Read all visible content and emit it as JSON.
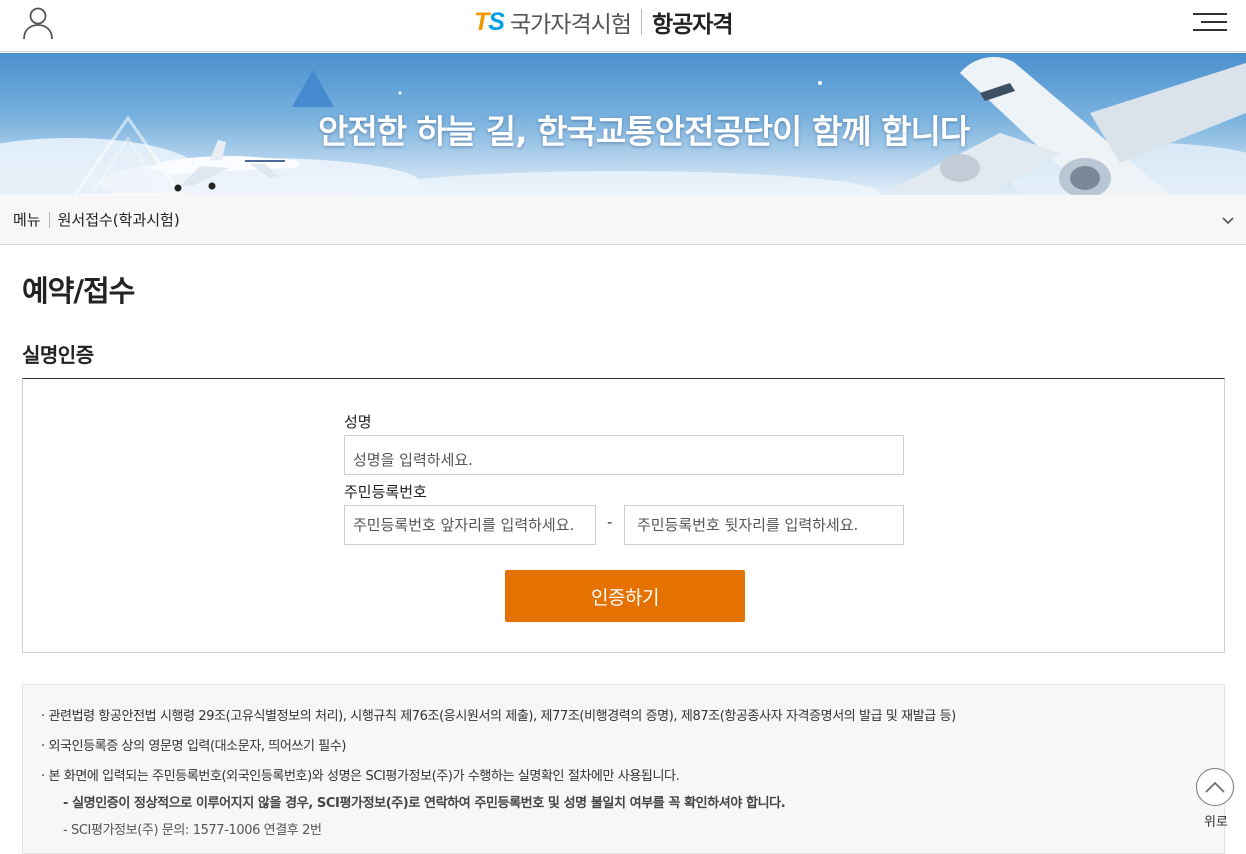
{
  "header": {
    "logo_t": "T",
    "logo_s": "S",
    "logo_name": "국가자격시험",
    "logo_sub": "항공자격",
    "user_icon": "user-icon",
    "menu_icon": "hamburger-menu-icon"
  },
  "banner": {
    "slogan": "안전한 하늘 길, 한국교통안전공단이 함께 합니다"
  },
  "breadcrumb": {
    "menu_label": "메뉴",
    "current": "원서접수(학과시험)",
    "chevron_icon": "chevron-down-icon"
  },
  "page": {
    "title": "예약/접수",
    "section_title": "실명인증"
  },
  "form": {
    "name_label": "성명",
    "name_placeholder": "성명을 입력하세요.",
    "rrn_label": "주민등록번호",
    "rrn_front_placeholder": "주민등록번호 앞자리를 입력하세요.",
    "rrn_dash": "-",
    "rrn_back_placeholder": "주민등록번호 뒷자리를 입력하세요.",
    "submit_label": "인증하기"
  },
  "notice": {
    "line1": "· 관련법령 항공안전법 시행령 29조(고유식별정보의 처리), 시행규칙 제76조(응시원서의 제출), 제77조(비행경력의 증명), 제87조(항공종사자 자격증명서의 발급 및 재발급 등)",
    "line2": "· 외국인등록증 상의 영문명 입력(대소문자, 띄어쓰기 필수)",
    "line3": "· 본 화면에 입력되는 주민등록번호(외국인등록번호)와 성명은 SCI평가정보(주)가 수행하는 실명확인 절차에만 사용됩니다.",
    "sub1": "- 실명인증이 정상적으로 이루어지지 않을 경우, SCI평가정보(주)로 연락하여 주민등록번호 및 성명 불일치 여부를 꼭 확인하셔야 합니다.",
    "sub2": "- SCI평가정보(주) 문의: 1577-1006 연결후 2번"
  },
  "top_button": {
    "label": "위로",
    "icon": "chevron-up-icon"
  },
  "colors": {
    "accent": "#e57200",
    "logo_t": "#f39800",
    "logo_s": "#00a0e9"
  }
}
